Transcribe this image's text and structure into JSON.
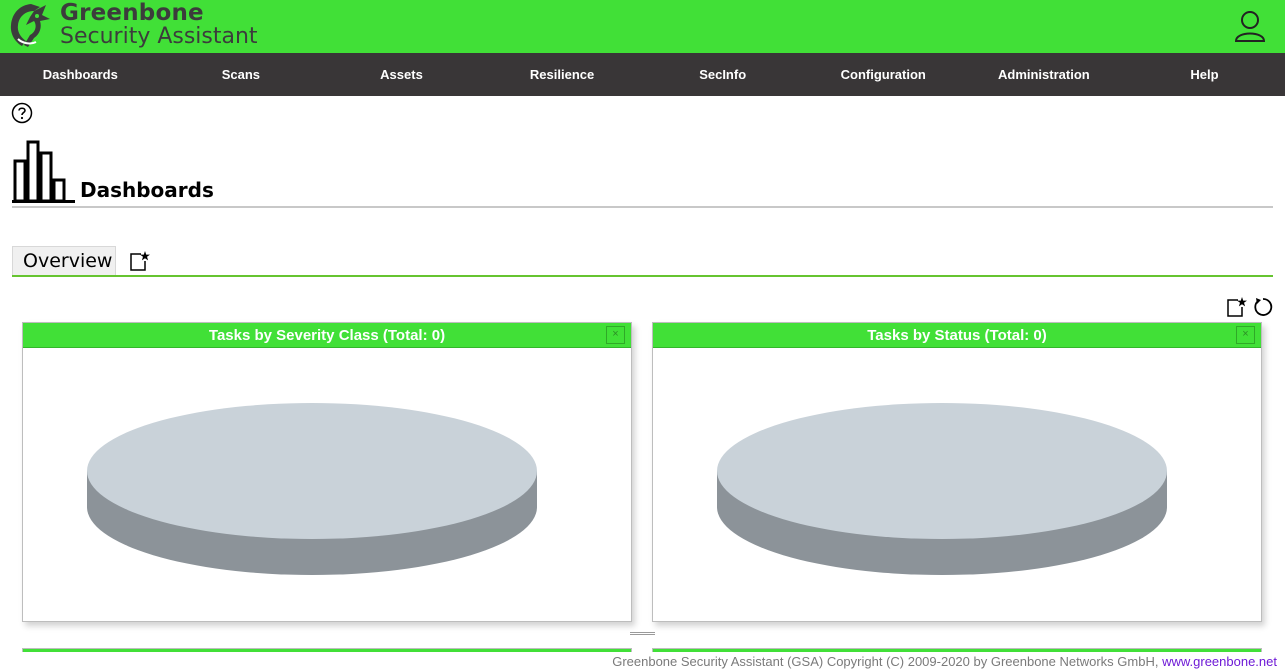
{
  "header": {
    "brand_line1": "Greenbone",
    "brand_line2": "Security Assistant",
    "logo_icon": "greenbone-dragon-logo",
    "user_icon": "user-icon"
  },
  "nav": {
    "items": [
      "Dashboards",
      "Scans",
      "Assets",
      "Resilience",
      "SecInfo",
      "Configuration",
      "Administration",
      "Help"
    ]
  },
  "page": {
    "title": "Dashboards",
    "help_icon": "help-icon",
    "title_icon": "dashboard-bar-chart-icon"
  },
  "tabs": {
    "items": [
      {
        "label": "Overview"
      }
    ],
    "add_icon": "new-dashboard-icon"
  },
  "toolbar": {
    "add_icon": "add-display-icon",
    "reload_icon": "reset-icon"
  },
  "panels": [
    {
      "title": "Tasks by Severity Class (Total: 0)",
      "close_label": "×"
    },
    {
      "title": "Tasks by Status (Total: 0)",
      "close_label": "×"
    }
  ],
  "colors": {
    "brand_green": "#41e037",
    "nav_bg": "#393637",
    "pie_top": "#c9d2d9",
    "pie_side": "#8c9399"
  },
  "footer": {
    "text": "Greenbone Security Assistant (GSA) Copyright (C) 2009-2020 by Greenbone Networks GmbH, ",
    "link": "www.greenbone.net"
  }
}
